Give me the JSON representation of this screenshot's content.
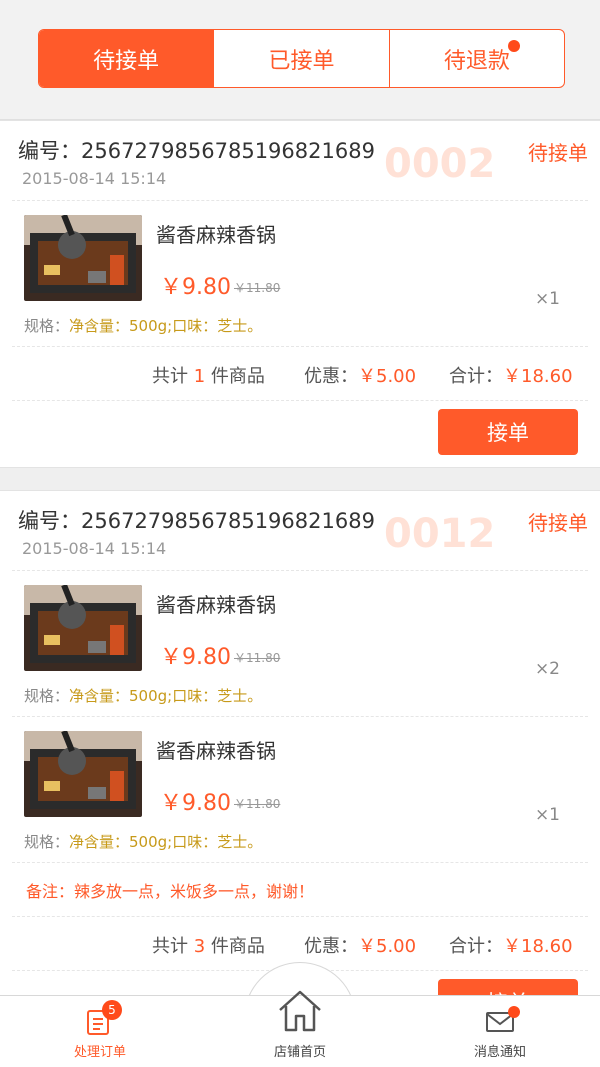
{
  "tabs": [
    {
      "label": "待接单",
      "active": true
    },
    {
      "label": "已接单",
      "active": false
    },
    {
      "label": "待退款",
      "active": false,
      "has_dot": true
    }
  ],
  "orders": [
    {
      "number": "编号：25672798567851968216​89",
      "time": "2015-08-14 15:14",
      "queue": "0002",
      "status": "待接单",
      "items": [
        {
          "name": "酱香麻辣香锅",
          "price": "￥9.80",
          "original_price": "￥11.80",
          "qty": "×1",
          "spec_label": "规格：",
          "spec_value": "净含量：500g;口味：芝士。"
        }
      ],
      "summary": {
        "count_prefix": "共计",
        "count": "1",
        "count_suffix": "件商品",
        "discount_label": "优惠：",
        "discount": "￥5.00",
        "total_label": "合计：",
        "total": "￥18.60"
      },
      "action": "接单"
    },
    {
      "number": "编号：25672798567851968216​89",
      "time": "2015-08-14 15:14",
      "queue": "0012",
      "status": "待接单",
      "items": [
        {
          "name": "酱香麻辣香锅",
          "price": "￥9.80",
          "original_price": "￥11.80",
          "qty": "×2",
          "spec_label": "规格：",
          "spec_value": "净含量：500g;口味：芝士。"
        },
        {
          "name": "酱香麻辣香锅",
          "price": "￥9.80",
          "original_price": "￥11.80",
          "qty": "×1",
          "spec_label": "规格：",
          "spec_value": "净含量：500g;口味：芝士。"
        }
      ],
      "remark": "备注：辣多放一点，米饭多一点，谢谢！",
      "summary": {
        "count_prefix": "共计",
        "count": "3",
        "count_suffix": "件商品",
        "discount_label": "优惠：",
        "discount": "￥5.00",
        "total_label": "合计：",
        "total": "￥18.60"
      },
      "action": "接单"
    }
  ],
  "bottom_nav": [
    {
      "label": "处理订单",
      "icon": "order-list-icon",
      "badge": "5",
      "active": true
    },
    {
      "label": "店铺首页",
      "icon": "home-icon",
      "active": false
    },
    {
      "label": "消息通知",
      "icon": "mail-icon",
      "has_dot": true,
      "active": false
    }
  ],
  "colors": {
    "accent": "#ff5a2a",
    "spec": "#c79a1a",
    "queue_watermark": "#ffe1d6"
  }
}
